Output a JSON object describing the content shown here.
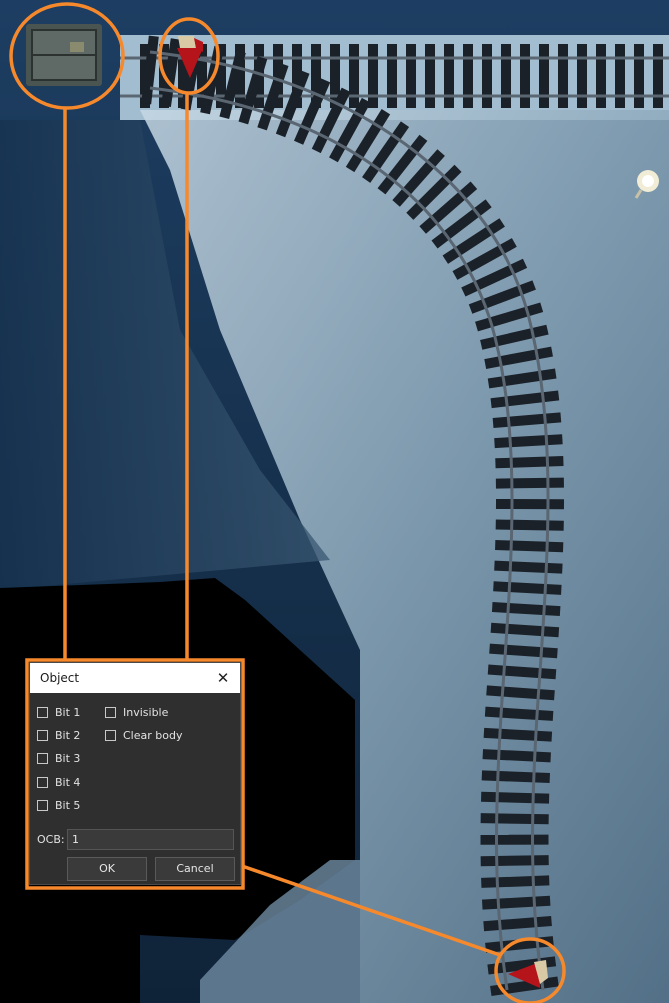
{
  "dialog": {
    "title": "Object",
    "close_symbol": "✕",
    "checkboxes_left": [
      {
        "label": "Bit 1",
        "checked": false
      },
      {
        "label": "Bit 2",
        "checked": false
      },
      {
        "label": "Bit 3",
        "checked": false
      },
      {
        "label": "Bit 4",
        "checked": false
      },
      {
        "label": "Bit 5",
        "checked": false
      }
    ],
    "checkboxes_right": [
      {
        "label": "Invisible",
        "checked": false
      },
      {
        "label": "Clear body",
        "checked": false
      }
    ],
    "ocb": {
      "label": "OCB:",
      "value": "1"
    },
    "ok_label": "OK",
    "cancel_label": "Cancel"
  },
  "scene": {
    "objects": [
      {
        "name": "mine-cart",
        "icon": "mine-cart-icon"
      },
      {
        "name": "track-marker-top",
        "icon": "red-triangle-marker-icon"
      },
      {
        "name": "track-marker-bottom",
        "icon": "red-triangle-marker-icon"
      },
      {
        "name": "light-bulb",
        "icon": "light-bulb-icon"
      }
    ],
    "colors": {
      "highlight": "#f7892d",
      "snow": "#b9cfdd",
      "shadow_blue": "#173553",
      "marker_red": "#b5141a",
      "rail": "#1b2128"
    }
  }
}
